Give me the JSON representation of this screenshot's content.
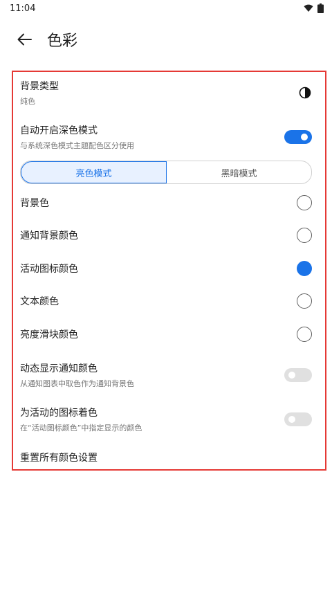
{
  "status_bar": {
    "time": "11:04"
  },
  "app_bar": {
    "title": "色彩"
  },
  "settings": {
    "background_type": {
      "label": "背景类型",
      "value": "纯色"
    },
    "auto_dark": {
      "label": "自动开启深色模式",
      "sub": "与系统深色模式主题配色区分使用",
      "enabled": true
    },
    "mode_tabs": {
      "light": "亮色模式",
      "dark": "黑暗模式",
      "selected": "light"
    },
    "colors": [
      {
        "label": "背景色",
        "selected": false
      },
      {
        "label": "通知背景颜色",
        "selected": false
      },
      {
        "label": "活动图标颜色",
        "selected": true
      },
      {
        "label": "文本颜色",
        "selected": false
      },
      {
        "label": "亮度滑块颜色",
        "selected": false
      }
    ],
    "dynamic_notify": {
      "label": "动态显示通知颜色",
      "sub": "从通知图表中取色作为通知背景色",
      "enabled": false
    },
    "tint_active_icons": {
      "label": "为活动的图标着色",
      "sub": "在“活动图标颜色”中指定显示的颜色",
      "enabled": false
    },
    "reset": {
      "label": "重置所有颜色设置"
    }
  },
  "colors": {
    "accent": "#1a73e8",
    "highlight_frame": "#e53935"
  }
}
